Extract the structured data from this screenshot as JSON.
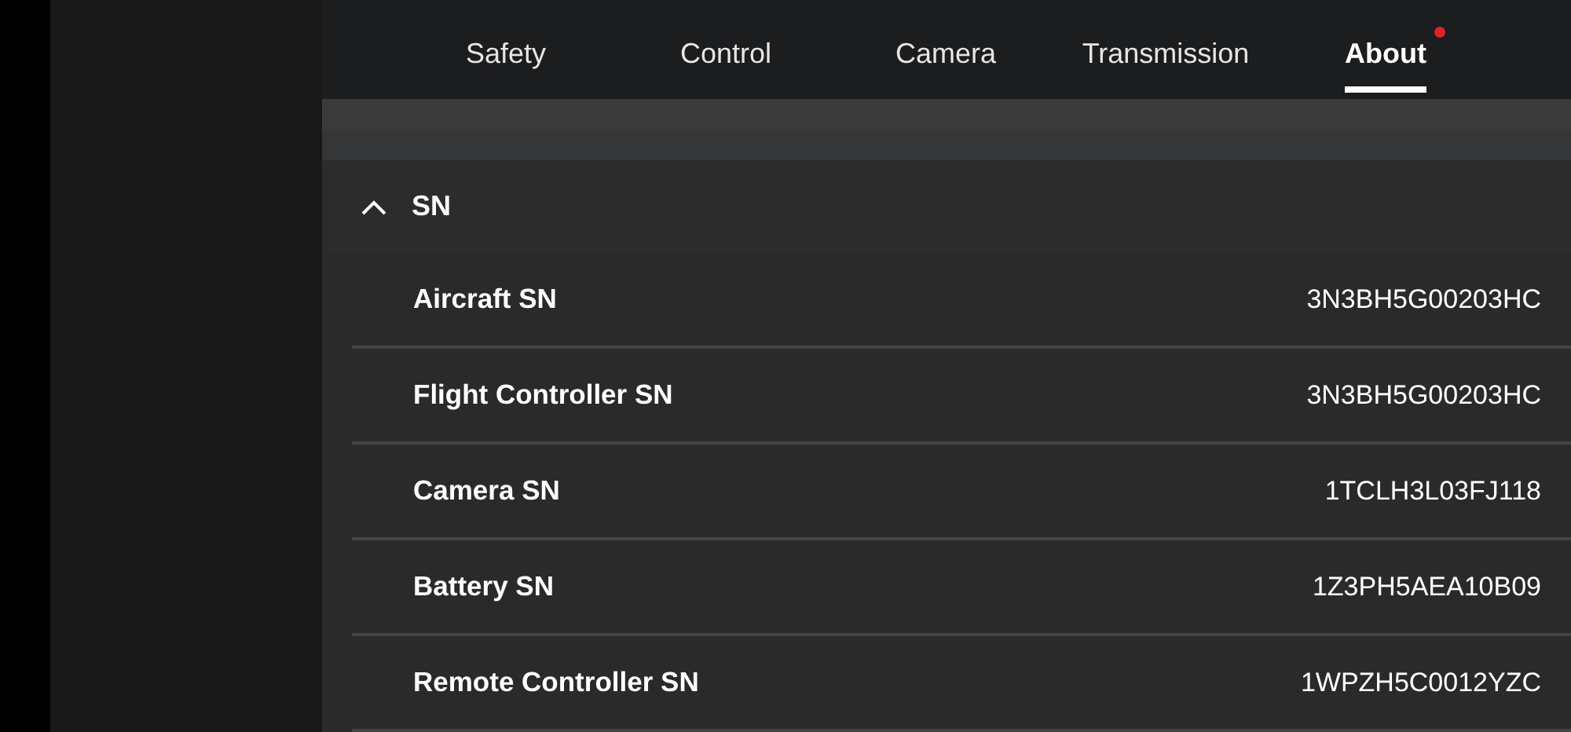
{
  "tabs": [
    {
      "label": "Safety",
      "selected": false,
      "notification": false
    },
    {
      "label": "Control",
      "selected": false,
      "notification": false
    },
    {
      "label": "Camera",
      "selected": false,
      "notification": false
    },
    {
      "label": "Transmission",
      "selected": false,
      "notification": false
    },
    {
      "label": "About",
      "selected": true,
      "notification": true
    }
  ],
  "section": {
    "title": "SN",
    "expanded": true,
    "rows": [
      {
        "label": "Aircraft SN",
        "value": "3N3BH5G00203HC"
      },
      {
        "label": "Flight Controller SN",
        "value": "3N3BH5G00203HC"
      },
      {
        "label": "Camera SN",
        "value": "1TCLH3L03FJ118"
      },
      {
        "label": "Battery SN",
        "value": "1Z3PH5AEA10B09"
      },
      {
        "label": "Remote Controller SN",
        "value": "1WPZH5C0012YZC"
      }
    ]
  }
}
